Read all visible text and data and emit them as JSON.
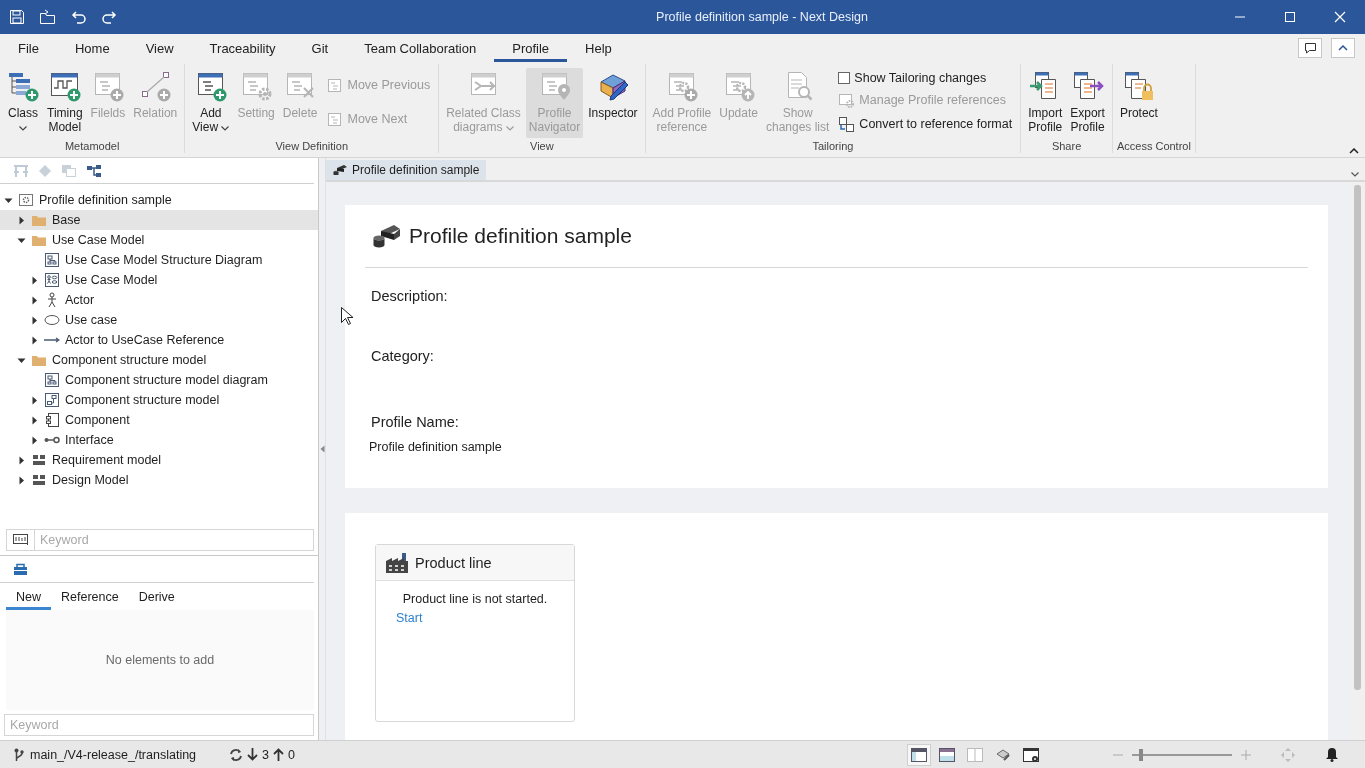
{
  "window": {
    "title": "Profile definition sample - Next Design"
  },
  "menu_tabs": [
    {
      "label": "File",
      "selected": false
    },
    {
      "label": "Home",
      "selected": false
    },
    {
      "label": "View",
      "selected": false
    },
    {
      "label": "Traceability",
      "selected": false
    },
    {
      "label": "Git",
      "selected": false
    },
    {
      "label": "Team Collaboration",
      "selected": false
    },
    {
      "label": "Profile",
      "selected": true
    },
    {
      "label": "Help",
      "selected": false
    }
  ],
  "ribbon": {
    "groups": [
      {
        "label": "Metamodel",
        "items": [
          {
            "kind": "class",
            "label": "Class",
            "dropdown": true,
            "disabled": false
          },
          {
            "kind": "timing",
            "label": "Timing\nModel",
            "disabled": false
          },
          {
            "kind": "fields",
            "label": "Filelds",
            "disabled": true
          },
          {
            "kind": "relation",
            "label": "Relation",
            "disabled": true
          }
        ]
      },
      {
        "label": "View Definition",
        "items": [
          {
            "kind": "add-view",
            "label": "Add\nView",
            "dropdown": true,
            "disabled": false
          },
          {
            "kind": "setting",
            "label": "Setting",
            "disabled": true
          },
          {
            "kind": "delete",
            "label": "Delete",
            "disabled": true
          },
          {
            "kind": "stack",
            "items": [
              {
                "kind": "move",
                "label": "Move Previous",
                "disabled": true
              },
              {
                "kind": "move",
                "label": "Move Next",
                "disabled": true
              }
            ]
          }
        ]
      },
      {
        "label": "View",
        "items": [
          {
            "kind": "related",
            "label": "Related Class\ndiagrams",
            "dropdown": true,
            "disabled": true,
            "pressed": false
          },
          {
            "kind": "navigator",
            "label": "Profile\nNavigator",
            "disabled": true,
            "pressed": true
          },
          {
            "kind": "inspector",
            "label": "Inspector",
            "disabled": false,
            "pressed": false
          }
        ]
      },
      {
        "label": "Tailoring",
        "items": [
          {
            "kind": "add-reference",
            "label": "Add Profile\nreference",
            "disabled": true
          },
          {
            "kind": "update",
            "label": "Update",
            "disabled": true
          },
          {
            "kind": "show-changes",
            "label": "Show\nchanges list",
            "disabled": true
          },
          {
            "kind": "stack",
            "items": [
              {
                "kind": "check",
                "label": "Show Tailoring changes",
                "checked": false,
                "disabled": false
              },
              {
                "kind": "manage",
                "label": "Manage Profile references",
                "disabled": true
              },
              {
                "kind": "convert",
                "label": "Convert to reference format",
                "disabled": false
              }
            ]
          }
        ]
      },
      {
        "label": "Share",
        "items": [
          {
            "kind": "import",
            "label": "Import\nProfile",
            "disabled": false
          },
          {
            "kind": "export",
            "label": "Export\nProfile",
            "disabled": false
          }
        ]
      },
      {
        "label": "Access Control",
        "items": [
          {
            "kind": "protect",
            "label": "Protect",
            "disabled": false
          }
        ]
      }
    ]
  },
  "tree": [
    {
      "label": "Profile definition sample",
      "kind": "profile",
      "expanded": true,
      "selected": false,
      "children": [
        {
          "label": "Base",
          "kind": "folder",
          "expanded": false,
          "selected": true
        },
        {
          "label": "Use Case Model",
          "kind": "folder",
          "expanded": true,
          "selected": false,
          "children": [
            {
              "label": "Use Case Model Structure Diagram",
              "kind": "diagram",
              "selected": false
            },
            {
              "label": "Use Case Model",
              "kind": "usecase-model",
              "expanded": false,
              "selected": false
            },
            {
              "label": "Actor",
              "kind": "actor",
              "expanded": false,
              "selected": false
            },
            {
              "label": "Use case",
              "kind": "usecase",
              "expanded": false,
              "selected": false
            },
            {
              "label": "Actor to UseCase Reference",
              "kind": "reference",
              "expanded": false,
              "selected": false
            }
          ]
        },
        {
          "label": "Component structure model",
          "kind": "folder",
          "expanded": true,
          "selected": false,
          "children": [
            {
              "label": "Component structure model diagram",
              "kind": "diagram",
              "selected": false
            },
            {
              "label": "Component structure model",
              "kind": "component-model",
              "expanded": false,
              "selected": false
            },
            {
              "label": "Component",
              "kind": "component",
              "expanded": false,
              "selected": false
            },
            {
              "label": "Interface",
              "kind": "interface",
              "expanded": false,
              "selected": false
            }
          ]
        },
        {
          "label": "Requirement model",
          "kind": "package",
          "expanded": false,
          "selected": false
        },
        {
          "label": "Design Model",
          "kind": "package",
          "expanded": false,
          "selected": false
        }
      ]
    }
  ],
  "tree_search": {
    "placeholder": "Keyword"
  },
  "toolbox": {
    "tabs": [
      {
        "label": "New",
        "selected": true
      },
      {
        "label": "Reference",
        "selected": false
      },
      {
        "label": "Derive",
        "selected": false
      }
    ],
    "empty_message": "No elements to add",
    "search": {
      "placeholder": "Keyword"
    }
  },
  "document_tab": {
    "label": "Profile definition sample"
  },
  "document": {
    "title": "Profile definition sample",
    "fields": [
      {
        "label": "Description:"
      },
      {
        "label": "Category:"
      },
      {
        "label": "Profile Name:",
        "value": "Profile definition sample"
      }
    ],
    "product_line": {
      "title": "Product line",
      "message": "Product line is not started.",
      "link": "Start"
    }
  },
  "status_bar": {
    "branch": "main_/V4-release_/translating",
    "incoming": "3",
    "outgoing": "0",
    "view_buttons": [
      {
        "kind": "left-pane",
        "selected": true
      },
      {
        "kind": "bottom-pane",
        "selected": false
      },
      {
        "kind": "split",
        "selected": false
      },
      {
        "kind": "brush",
        "selected": false
      },
      {
        "kind": "window-settings",
        "selected": false
      }
    ],
    "zoom": {
      "level": 0.07
    }
  }
}
